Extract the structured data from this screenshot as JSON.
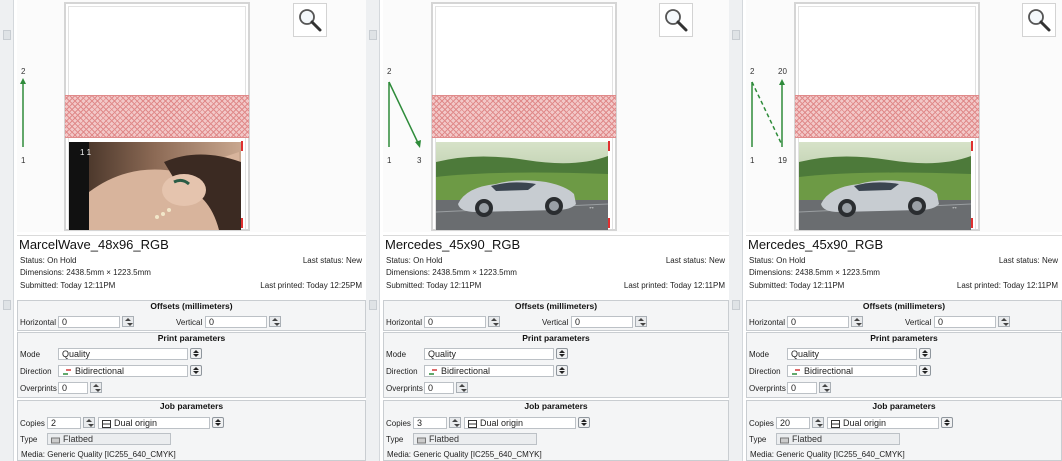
{
  "panels": [
    {
      "job_name": "MarcelWave_48x96_RGB",
      "status": "Status: On Hold",
      "last_status": "Last status: New",
      "dimensions": "Dimensions: 2438.5mm × 1223.5mm",
      "submitted": "Submitted: Today 12:11PM",
      "last_printed": "Last printed: Today 12:25PM",
      "path_labels": {
        "top_left": "2",
        "top_right": "",
        "bottom_left": "1",
        "bottom_right": ""
      },
      "photo_caption": "1  1",
      "photo": "portrait",
      "offsets_title": "Offsets (millimeters)",
      "horizontal_label": "Horizontal",
      "horizontal_value": "0",
      "vertical_label": "Vertical",
      "vertical_value": "0",
      "print_title": "Print parameters",
      "mode_label": "Mode",
      "mode_value": "Quality",
      "direction_label": "Direction",
      "direction_value": "Bidirectional",
      "overprints_label": "Overprints",
      "overprints_value": "0",
      "job_title": "Job parameters",
      "copies_label": "Copies",
      "copies_value": "2",
      "origin_value": "Dual origin",
      "type_label": "Type",
      "type_value": "Flatbed",
      "media": "Media: Generic Quality [IC255_640_CMYK]"
    },
    {
      "job_name": "Mercedes_45x90_RGB",
      "status": "Status: On Hold",
      "last_status": "Last status: New",
      "dimensions": "Dimensions: 2438.5mm × 1223.5mm",
      "submitted": "Submitted: Today 12:11PM",
      "last_printed": "Last printed: Today 12:11PM",
      "path_labels": {
        "top_left": "2",
        "top_right": "",
        "bottom_left": "1",
        "bottom_right": "3"
      },
      "photo_caption": "",
      "photo": "car",
      "offsets_title": "Offsets (millimeters)",
      "horizontal_label": "Horizontal",
      "horizontal_value": "0",
      "vertical_label": "Vertical",
      "vertical_value": "0",
      "print_title": "Print parameters",
      "mode_label": "Mode",
      "mode_value": "Quality",
      "direction_label": "Direction",
      "direction_value": "Bidirectional",
      "overprints_label": "Overprints",
      "overprints_value": "0",
      "job_title": "Job parameters",
      "copies_label": "Copies",
      "copies_value": "3",
      "origin_value": "Dual origin",
      "type_label": "Type",
      "type_value": "Flatbed",
      "media": "Media: Generic Quality [IC255_640_CMYK]"
    },
    {
      "job_name": "Mercedes_45x90_RGB",
      "status": "Status: On Hold",
      "last_status": "Last status: New",
      "dimensions": "Dimensions: 2438.5mm × 1223.5mm",
      "submitted": "Submitted: Today 12:11PM",
      "last_printed": "Last printed: Today 12:11PM",
      "path_labels": {
        "top_left": "2",
        "top_right": "20",
        "bottom_left": "1",
        "bottom_right": "19"
      },
      "photo_caption": "",
      "photo": "car",
      "offsets_title": "Offsets (millimeters)",
      "horizontal_label": "Horizontal",
      "horizontal_value": "0",
      "vertical_label": "Vertical",
      "vertical_value": "0",
      "print_title": "Print parameters",
      "mode_label": "Mode",
      "mode_value": "Quality",
      "direction_label": "Direction",
      "direction_value": "Bidirectional",
      "overprints_label": "Overprints",
      "overprints_value": "0",
      "job_title": "Job parameters",
      "copies_label": "Copies",
      "copies_value": "20",
      "origin_value": "Dual origin",
      "type_label": "Type",
      "type_value": "Flatbed",
      "media": "Media: Generic Quality [IC255_640_CMYK]"
    }
  ],
  "colors": {
    "path_green": "#2e8b3a",
    "hatch_red": "#e08a8a",
    "mark_red": "#e03030",
    "section_bg": "#f4f5f6"
  },
  "icons": {
    "zoom": "magnifier-icon",
    "direction": "bidirectional-arrows-icon",
    "origin": "dual-origin-icon",
    "type": "flatbed-icon"
  }
}
